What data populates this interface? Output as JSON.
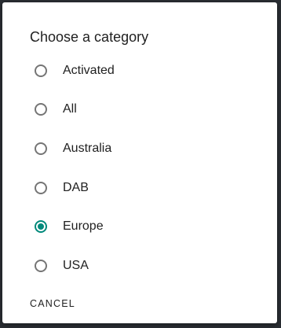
{
  "dialog": {
    "title": "Choose a category",
    "options": [
      {
        "label": "Activated",
        "checked": false
      },
      {
        "label": "All",
        "checked": false
      },
      {
        "label": "Australia",
        "checked": false
      },
      {
        "label": "DAB",
        "checked": false
      },
      {
        "label": "Europe",
        "checked": true
      },
      {
        "label": "USA",
        "checked": false
      }
    ],
    "cancel_label": "CANCEL"
  },
  "colors": {
    "accent": "#00897b",
    "radio_unchecked": "#757575",
    "text": "#212121",
    "backdrop": "#2a2e33"
  },
  "icons": {
    "radio_checked": "radio-checked-icon",
    "radio_unchecked": "radio-unchecked-icon"
  }
}
